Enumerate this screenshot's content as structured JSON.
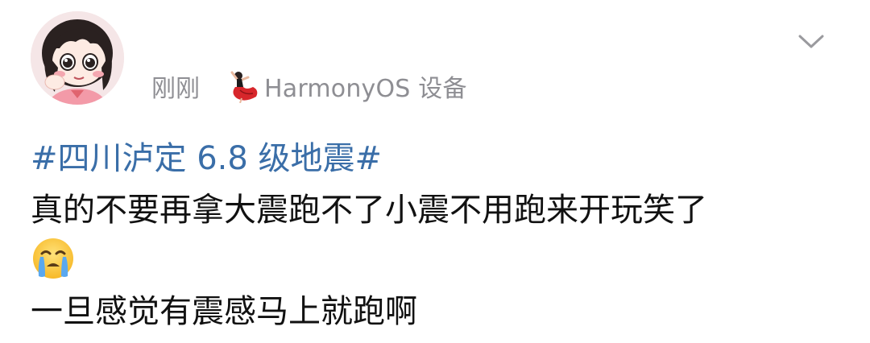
{
  "post": {
    "time": "刚刚",
    "device": "HarmonyOS 设备",
    "hashtag": "#四川泸定 6.8 级地震#",
    "lines": [
      "真的不要再拿大震跑不了小震不用跑来开玩笑了",
      "一旦感觉有震感马上就跑啊"
    ],
    "emoji": "crying-face",
    "icons": {
      "collapse": "chevron-down-icon",
      "device_badge": "dancer-icon"
    }
  },
  "colors": {
    "hashtag": "#3a6ea8",
    "meta_text": "#8e8e93",
    "body_text": "#111111"
  }
}
